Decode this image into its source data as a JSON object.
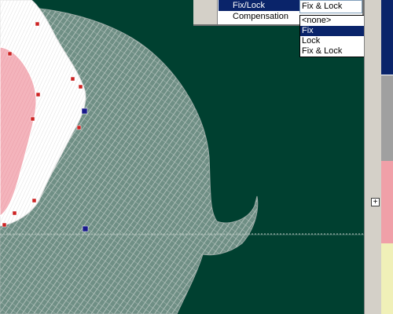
{
  "properties_panel": {
    "rows": [
      {
        "label": "Fix/Lock"
      },
      {
        "label": "Compensation"
      }
    ],
    "current_value": "Fix & Lock"
  },
  "dropdown": {
    "options": [
      "<none>",
      "Fix",
      "Lock",
      "Fix & Lock"
    ],
    "selected_index": 1
  },
  "sidebar": {
    "swatch_colors": [
      "#a0a0a0",
      "#ffffff",
      "#f0a0a8",
      "#f0f0b8"
    ],
    "expand_symbol": "+"
  },
  "colors": {
    "canvas_bg": "#004030",
    "selection": "#0a246a",
    "node_red": "#cc2222",
    "node_blue": "#1a1a8c"
  }
}
